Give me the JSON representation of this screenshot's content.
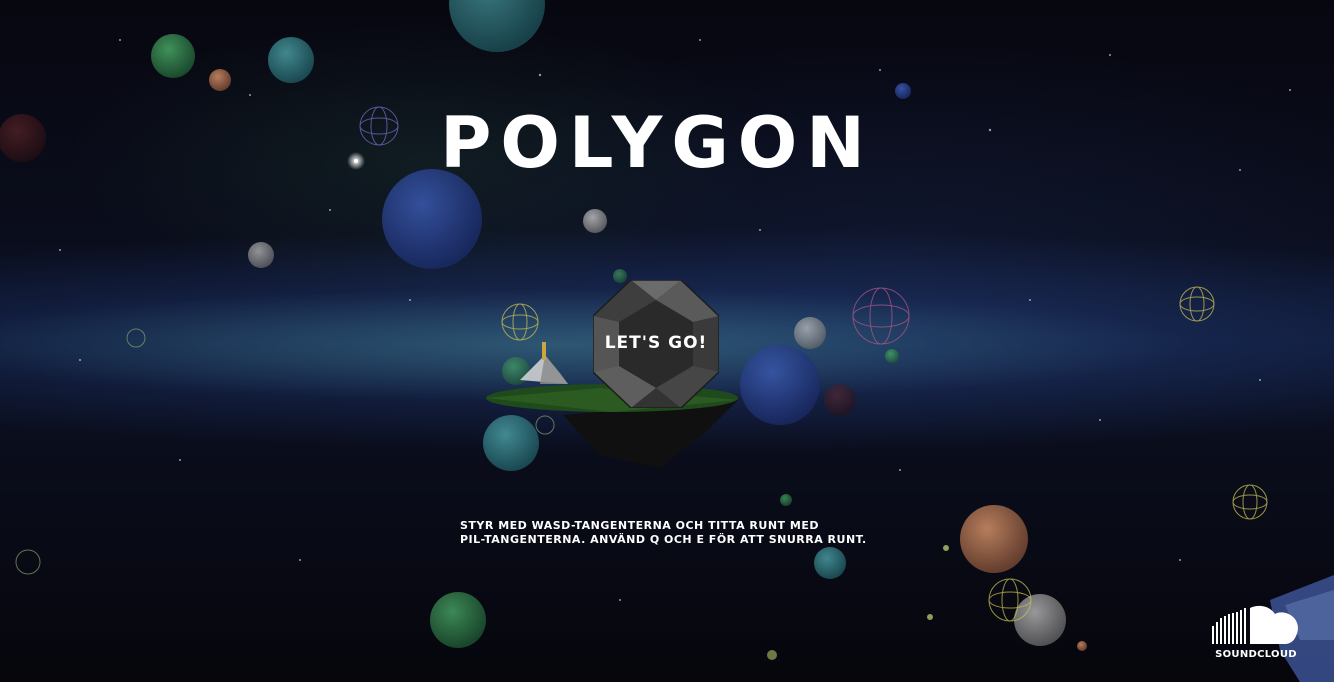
{
  "app": {
    "title": "POLYGON"
  },
  "start": {
    "label": "LET'S GO!"
  },
  "instructions": {
    "line1": "STYR MED WASD-TANGENTERNA OCH TITTA RUNT MED",
    "line2": "PIL-TANGENTERNA. ANVÄND Q OCH E FÖR ATT SNURRA RUNT."
  },
  "footer": {
    "soundcloud_label": "SOUNDCLOUD",
    "soundcloud_icon": "soundcloud-icon"
  },
  "colors": {
    "background": "#05060c",
    "milky_way": "#2f6f7a",
    "text": "#ffffff",
    "button_face": "#4a4a4a"
  }
}
